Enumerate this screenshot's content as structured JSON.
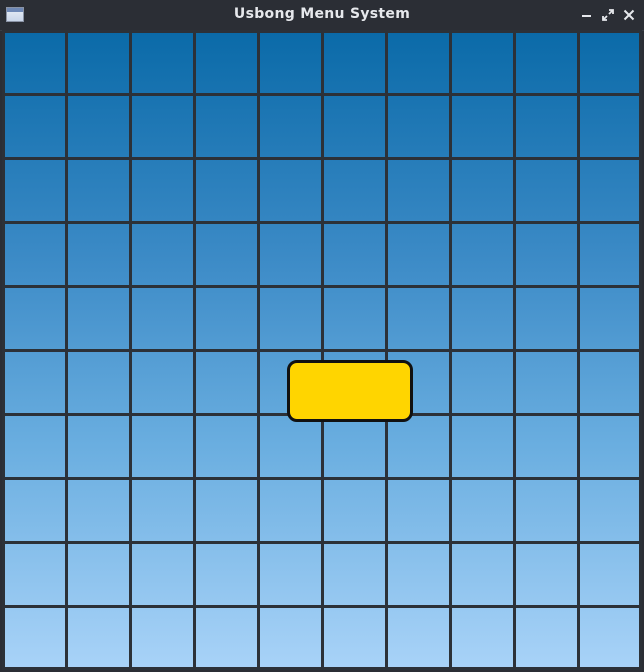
{
  "window": {
    "title": "Usbong Menu System",
    "app_icon": "window-icon",
    "controls": {
      "minimize_icon": "minimize-icon",
      "maximize_icon": "maximize-icon",
      "close_icon": "close-icon"
    }
  },
  "canvas": {
    "grid_rows": 10,
    "grid_cols": 10,
    "background_top_color": "#0a6aa8",
    "background_bottom_color": "#a9d3f8",
    "grid_line_color": "#2c3138"
  },
  "menu_button": {
    "label": "",
    "fill_color": "#ffd500",
    "border_color": "#111111"
  }
}
